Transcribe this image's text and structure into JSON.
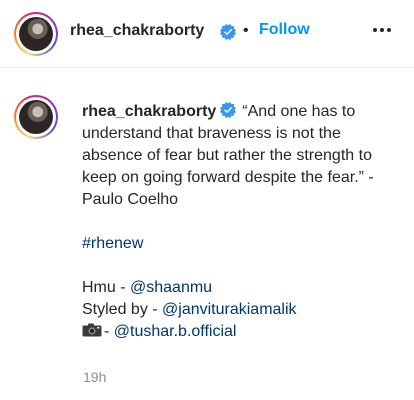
{
  "header": {
    "username": "rhea_chakraborty",
    "separator": "•",
    "follow_label": "Follow",
    "more_icon": "more-horizontal-icon",
    "verified_icon": "verified-badge-icon"
  },
  "caption": {
    "username": "rhea_chakraborty",
    "quote": "“And one has to understand that braveness is not the absence of fear but rather the strength to keep on going forward despite the fear.” -Paulo Coelho",
    "hashtag": "#rhenew",
    "hmu_prefix": "Hmu - ",
    "hmu_handle": "@shaanmu",
    "styled_prefix": "Styled by - ",
    "styled_handle": "@janviturakiamalik",
    "camera_icon": "camera-emoji-icon",
    "photo_prefix": "- ",
    "photo_handle": "@tushar.b.official"
  },
  "timestamp": "19h",
  "colors": {
    "accent_blue": "#0095f6",
    "link_blue": "#00376b",
    "text": "#262626",
    "muted": "#8e8e8e",
    "divider": "#efefef"
  }
}
